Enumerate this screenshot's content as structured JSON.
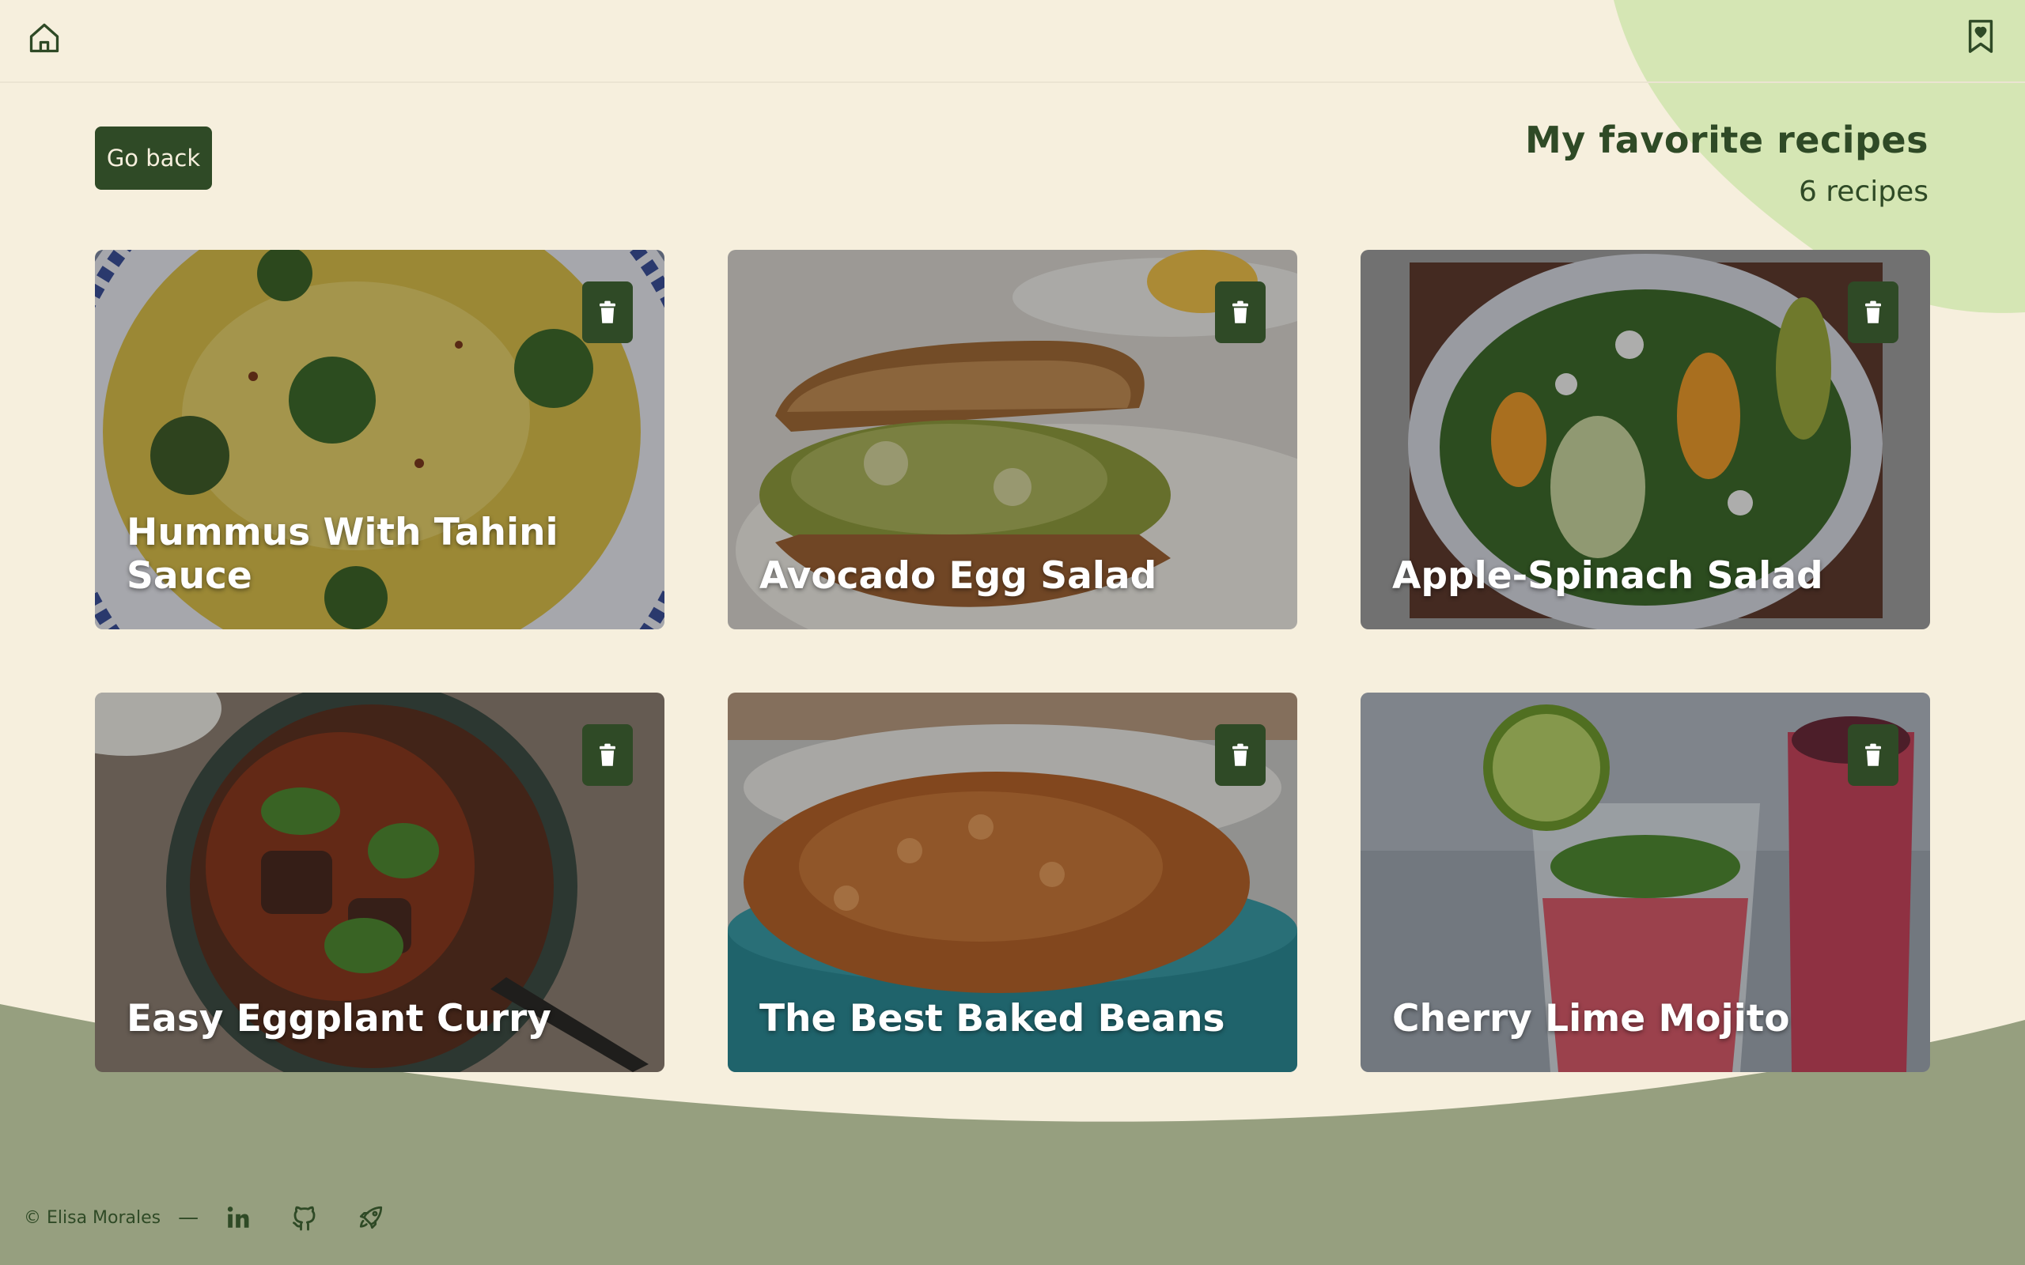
{
  "nav": {
    "home_icon": "home-icon",
    "bookmark_icon": "bookmark-heart-icon"
  },
  "header": {
    "back_label": "Go back",
    "title": "My favorite recipes",
    "count": "6 recipes"
  },
  "recipes": [
    {
      "title": "Hummus With Tahini Sauce"
    },
    {
      "title": "Avocado Egg Salad"
    },
    {
      "title": "Apple-Spinach Salad"
    },
    {
      "title": "Easy Eggplant Curry"
    },
    {
      "title": "The Best Baked Beans"
    },
    {
      "title": "Cherry Lime Mojito"
    }
  ],
  "footer": {
    "copyright": "© Elisa Morales",
    "separator": "—",
    "social_icons": [
      "linkedin-icon",
      "github-icon",
      "rocket-icon"
    ]
  },
  "colors": {
    "background": "#f6efdd",
    "accent_dark_green": "#2f4a26",
    "blob_light_green": "#d5e6b4",
    "footer_sage": "#969f7f"
  }
}
